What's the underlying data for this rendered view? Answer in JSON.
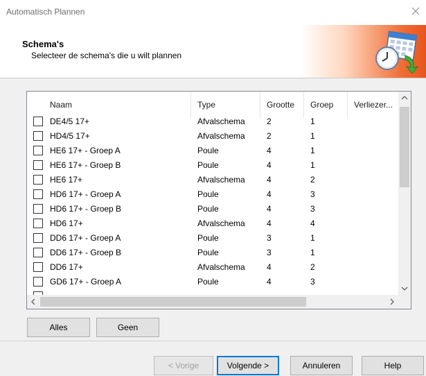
{
  "window": {
    "title": "Automatisch Plannen"
  },
  "header": {
    "title": "Schema's",
    "subtitle": "Selecteer de schema's die u wilt plannen"
  },
  "table": {
    "columns": [
      "Naam",
      "Type",
      "Grootte",
      "Groep",
      "Verliezer..."
    ],
    "rows": [
      {
        "naam": "DE4/5 17+",
        "type": "Afvalschema",
        "grootte": "2",
        "groep": "1"
      },
      {
        "naam": "HD4/5 17+",
        "type": "Afvalschema",
        "grootte": "2",
        "groep": "1"
      },
      {
        "naam": "HE6 17+ - Groep A",
        "type": "Poule",
        "grootte": "4",
        "groep": "1"
      },
      {
        "naam": "HE6 17+ - Groep B",
        "type": "Poule",
        "grootte": "4",
        "groep": "1"
      },
      {
        "naam": "HE6 17+",
        "type": "Afvalschema",
        "grootte": "4",
        "groep": "2"
      },
      {
        "naam": "HD6 17+ - Groep A",
        "type": "Poule",
        "grootte": "4",
        "groep": "3"
      },
      {
        "naam": "HD6 17+ - Groep B",
        "type": "Poule",
        "grootte": "4",
        "groep": "3"
      },
      {
        "naam": "HD6 17+",
        "type": "Afvalschema",
        "grootte": "4",
        "groep": "4"
      },
      {
        "naam": "DD6 17+ - Groep A",
        "type": "Poule",
        "grootte": "3",
        "groep": "1"
      },
      {
        "naam": "DD6 17+ - Groep B",
        "type": "Poule",
        "grootte": "3",
        "groep": "1"
      },
      {
        "naam": "DD6 17+",
        "type": "Afvalschema",
        "grootte": "4",
        "groep": "2"
      },
      {
        "naam": "GD6 17+ - Groep A",
        "type": "Poule",
        "grootte": "4",
        "groep": "3"
      },
      {
        "naam": "",
        "type": "",
        "grootte": "",
        "groep": ""
      }
    ]
  },
  "selection_buttons": {
    "all": "Alles",
    "none": "Geen"
  },
  "footer": {
    "prev": "< Vorige",
    "next": "Volgende >",
    "cancel": "Annuleren",
    "help": "Help"
  }
}
